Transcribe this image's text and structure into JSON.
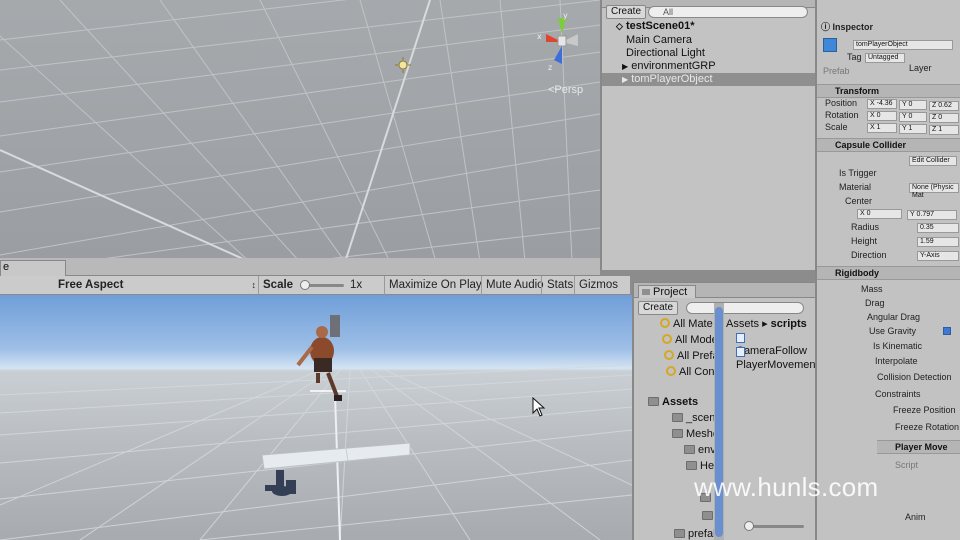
{
  "scene": {
    "persp_label": "<Persp",
    "gizmo_axes": {
      "x": "x",
      "y": "y",
      "z": "z"
    }
  },
  "game": {
    "tab_label": "e",
    "aspect": "Free Aspect",
    "scale_label": "Scale",
    "scale_value": "1x",
    "maximize": "Maximize On Play",
    "mute": "Mute Audio",
    "stats": "Stats",
    "gizmos": "Gizmos"
  },
  "hierarchy": {
    "create": "Create",
    "search": "All",
    "rows": [
      {
        "label": "testScene01*"
      },
      {
        "label": "Main Camera"
      },
      {
        "label": "Directional Light"
      },
      {
        "label": "environmentGRP"
      },
      {
        "label": "tomPlayerObject"
      }
    ]
  },
  "inspector": {
    "title": "Inspector",
    "object_name": "tomPlayerObject",
    "tag_label": "Tag",
    "tag_value": "Untagged",
    "layer_label": "Layer",
    "prefab_label": "Prefab",
    "transform": {
      "header": "Transform",
      "rows": [
        "Position",
        "Rotation",
        "Scale"
      ],
      "pos": [
        "X -4.36",
        "Y 0",
        "Z 0.62"
      ],
      "rot": [
        "X 0",
        "Y 0",
        "Z 0"
      ],
      "scl": [
        "X 1",
        "Y 1",
        "Z 1"
      ]
    },
    "capsule": {
      "header": "Capsule Collider",
      "edit": "Edit Collider",
      "rows": [
        "Is Trigger",
        "Material",
        "Center",
        "Radius",
        "Height",
        "Direction"
      ],
      "material_value": "None (Physic Mat",
      "center": [
        "X 0",
        "Y 0.797"
      ],
      "radius": "0.35",
      "height": "1.59",
      "direction": "Y-Axis"
    },
    "rigidbody": {
      "header": "Rigidbody",
      "rows": [
        "Mass",
        "Drag",
        "Angular Drag",
        "Use Gravity",
        "Is Kinematic",
        "Interpolate",
        "Collision Detection",
        "Constraints",
        "Freeze Position",
        "Freeze Rotation"
      ]
    },
    "player_header": "Player Move",
    "script_label": "Script",
    "anim_label": "Anim"
  },
  "project": {
    "tab": "Project",
    "create": "Create",
    "favorites": [
      "All Mate",
      "All Mode",
      "All Prefa",
      "All Confi"
    ],
    "tree": [
      {
        "label": "Assets"
      },
      {
        "label": "_scenes"
      },
      {
        "label": "Meshes"
      },
      {
        "label": "envir"
      },
      {
        "label": "Hero"
      },
      {
        "label": "Ma"
      },
      {
        "label": "tex"
      },
      {
        "label": "prefabs"
      }
    ],
    "breadcrumb_root": "Assets",
    "breadcrumb_sep": "▸",
    "breadcrumb_leaf": "scripts",
    "files": [
      "CameraFollow",
      "PlayerMovement"
    ]
  },
  "watermark": "www.hunls.com"
}
